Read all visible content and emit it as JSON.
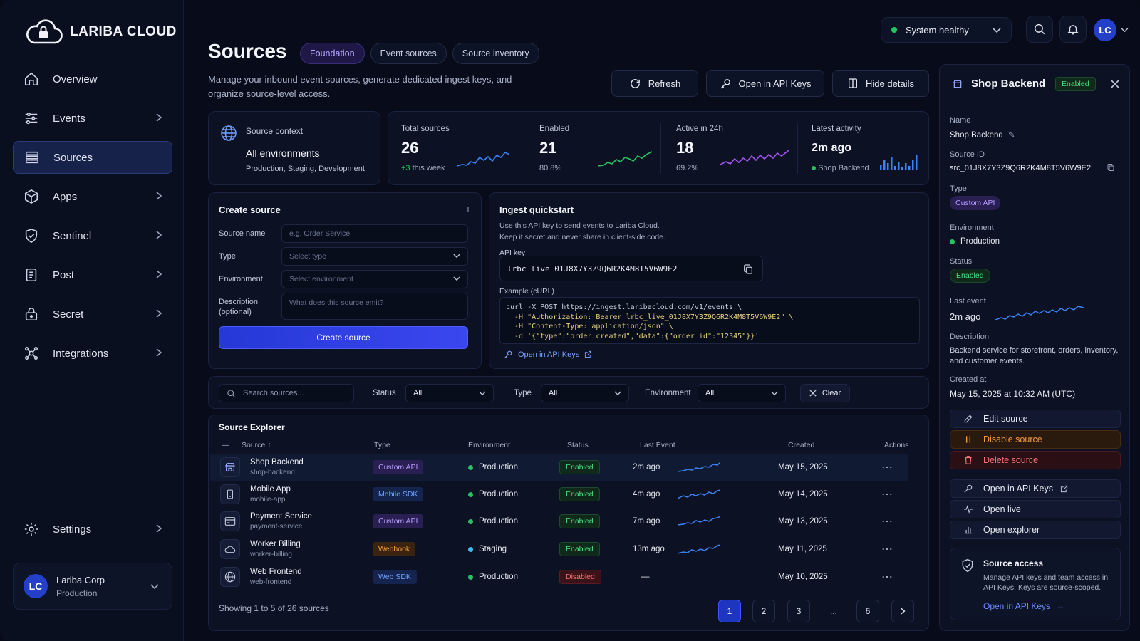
{
  "brand": {
    "name": "LARIBA CLOUD"
  },
  "nav": [
    {
      "label": "Overview",
      "icon": "home-icon"
    },
    {
      "label": "Events",
      "icon": "sliders-icon"
    },
    {
      "label": "Sources",
      "icon": "list-icon"
    },
    {
      "label": "Apps",
      "icon": "cube-icon"
    },
    {
      "label": "Sentinel",
      "icon": "shield-icon"
    },
    {
      "label": "Post",
      "icon": "document-icon"
    },
    {
      "label": "Secret",
      "icon": "lock-icon"
    },
    {
      "label": "Integrations",
      "icon": "network-icon"
    }
  ],
  "settings": {
    "label": "Settings"
  },
  "org": {
    "initials": "LC",
    "name": "Lariba Corp",
    "env": "Production"
  },
  "header": {
    "title": "Sources",
    "tabs": [
      "Foundation",
      "Event sources",
      "Source inventory"
    ],
    "subtitle": "Manage your inbound event sources, generate dedicated ingest keys, and organize source-level access.",
    "system_status": "System healthy",
    "user_initials": "LC",
    "buttons": {
      "refresh": "Refresh",
      "open_api_keys": "Open in API Keys",
      "hide_details": "Hide details"
    }
  },
  "context": {
    "label": "Source context",
    "value": "All environments",
    "sub": "Production, Staging, Development"
  },
  "stats": [
    {
      "label": "Total sources",
      "value": "26",
      "delta": "+3",
      "sub": "this week"
    },
    {
      "label": "Enabled",
      "value": "21",
      "sub": "80.8%"
    },
    {
      "label": "Active in 24h",
      "value": "18",
      "sub": "69.2%"
    },
    {
      "label": "Latest activity",
      "value": "2m ago",
      "sub": "Shop Backend"
    }
  ],
  "create": {
    "title": "Create source",
    "fields": {
      "name_label": "Source name",
      "name_placeholder": "e.g. Order Service",
      "type_label": "Type",
      "type_placeholder": "Select type",
      "env_label": "Environment",
      "env_placeholder": "Select environment",
      "desc_label": "Description",
      "desc_label2": "(optional)",
      "desc_placeholder": "What does this source emit?"
    },
    "button": "Create source"
  },
  "quickstart": {
    "title": "Ingest quickstart",
    "desc1": "Use this API key to send events to Lariba Cloud.",
    "desc2": "Keep it secret and never share in client-side code.",
    "api_key_label": "API key",
    "api_key": "lrbc_live_01J8X7Y3Z9Q6R2K4M8T5V6W9E2",
    "example_label": "Example (cURL)",
    "code": [
      "curl -X POST https://ingest.laribacloud.com/v1/events \\",
      "  -H \"Authorization: Bearer lrbc_live_01J8X7Y3Z9Q6R2K4M8T5V6W9E2\" \\",
      "  -H \"Content-Type: application/json\" \\",
      "  -d '{\"type\":\"order.created\",\"data\":{\"order_id\":\"12345\"}}'"
    ],
    "link": "Open in API Keys"
  },
  "filters": {
    "search_placeholder": "Search sources...",
    "status_label": "Status",
    "status_value": "All",
    "type_label": "Type",
    "type_value": "All",
    "env_label": "Environment",
    "env_value": "All",
    "clear": "Clear"
  },
  "explorer": {
    "title": "Source Explorer",
    "columns": [
      "Source",
      "Type",
      "Environment",
      "Status",
      "Last Event",
      "Created",
      "Actions"
    ],
    "rows": [
      {
        "name": "Shop Backend",
        "slug": "shop-backend",
        "type": "Custom API",
        "type_color": "purple",
        "env": "Production",
        "env_color": "#22c55e",
        "status": "Enabled",
        "last": "2m ago",
        "created": "May 15, 2025",
        "icon": "store-icon"
      },
      {
        "name": "Mobile App",
        "slug": "mobile-app",
        "type": "Mobile SDK",
        "type_color": "blue",
        "env": "Production",
        "env_color": "#22c55e",
        "status": "Enabled",
        "last": "4m ago",
        "created": "May 14, 2025",
        "icon": "phone-icon"
      },
      {
        "name": "Payment Service",
        "slug": "payment-service",
        "type": "Custom API",
        "type_color": "purple",
        "env": "Production",
        "env_color": "#22c55e",
        "status": "Enabled",
        "last": "7m ago",
        "created": "May 13, 2025",
        "icon": "card-icon"
      },
      {
        "name": "Worker Billing",
        "slug": "worker-billing",
        "type": "Webhook",
        "type_color": "orange",
        "env": "Staging",
        "env_color": "#38bdf8",
        "status": "Enabled",
        "last": "13m ago",
        "created": "May 11, 2025",
        "icon": "cloud-icon"
      },
      {
        "name": "Web Frontend",
        "slug": "web-frontend",
        "type": "Web SDK",
        "type_color": "blue",
        "env": "Production",
        "env_color": "#22c55e",
        "status": "Disabled",
        "last": "—",
        "created": "May 10, 2025",
        "icon": "globe-icon"
      }
    ],
    "showing": "Showing 1 to 5 of 26 sources",
    "pages": [
      "1",
      "2",
      "3",
      "...",
      "6"
    ]
  },
  "details": {
    "title": "Shop Backend",
    "badge": "Enabled",
    "name_label": "Name",
    "name": "Shop Backend",
    "id_label": "Source ID",
    "id": "src_01J8X7Y3Z9Q6R2K4M8T5V6W9E2",
    "type_label": "Type",
    "type": "Custom API",
    "env_label": "Environment",
    "env": "Production",
    "status_label": "Status",
    "status": "Enabled",
    "last_label": "Last event",
    "last": "2m ago",
    "desc_label": "Description",
    "desc": "Backend service for storefront, orders, inventory, and customer events.",
    "created_label": "Created at",
    "created": "May 15, 2025 at 10:32 AM (UTC)",
    "actions": [
      "Edit source",
      "Disable source",
      "Delete source",
      "Open in API Keys",
      "Open live",
      "Open explorer"
    ],
    "access_title": "Source access",
    "access_desc": "Manage API keys and team access in API Keys. Keys are source-scoped.",
    "access_link": "Open in API Keys"
  },
  "colors": {
    "accent": "#3a47ef",
    "success": "#22c55e",
    "danger": "#f87171",
    "warning": "#f59b3a",
    "purple": "#b39bff"
  }
}
